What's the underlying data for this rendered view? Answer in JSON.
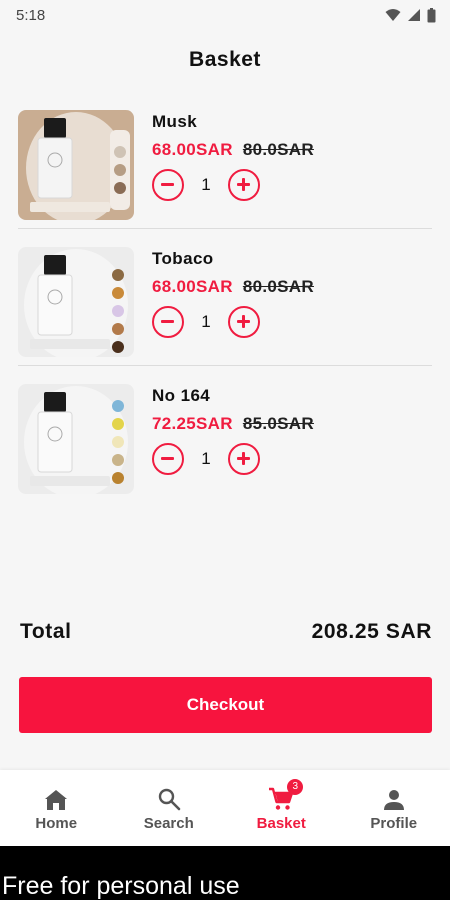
{
  "status": {
    "time": "5:18"
  },
  "header": {
    "title": "Basket"
  },
  "items": [
    {
      "name": "Musk",
      "price": "68.00SAR",
      "old_price": "80.0SAR",
      "qty": "1"
    },
    {
      "name": "Tobaco",
      "price": "68.00SAR",
      "old_price": "80.0SAR",
      "qty": "1"
    },
    {
      "name": "No 164",
      "price": "72.25SAR",
      "old_price": "85.0SAR",
      "qty": "1"
    }
  ],
  "total": {
    "label": "Total",
    "value": "208.25 SAR"
  },
  "checkout": {
    "label": "Checkout"
  },
  "nav": {
    "home": "Home",
    "search": "Search",
    "basket": "Basket",
    "basket_badge": "3",
    "profile": "Profile"
  },
  "footer": {
    "text": "Free for personal use"
  },
  "colors": {
    "accent": "#f01c40",
    "checkout_bg": "#f7143e"
  }
}
